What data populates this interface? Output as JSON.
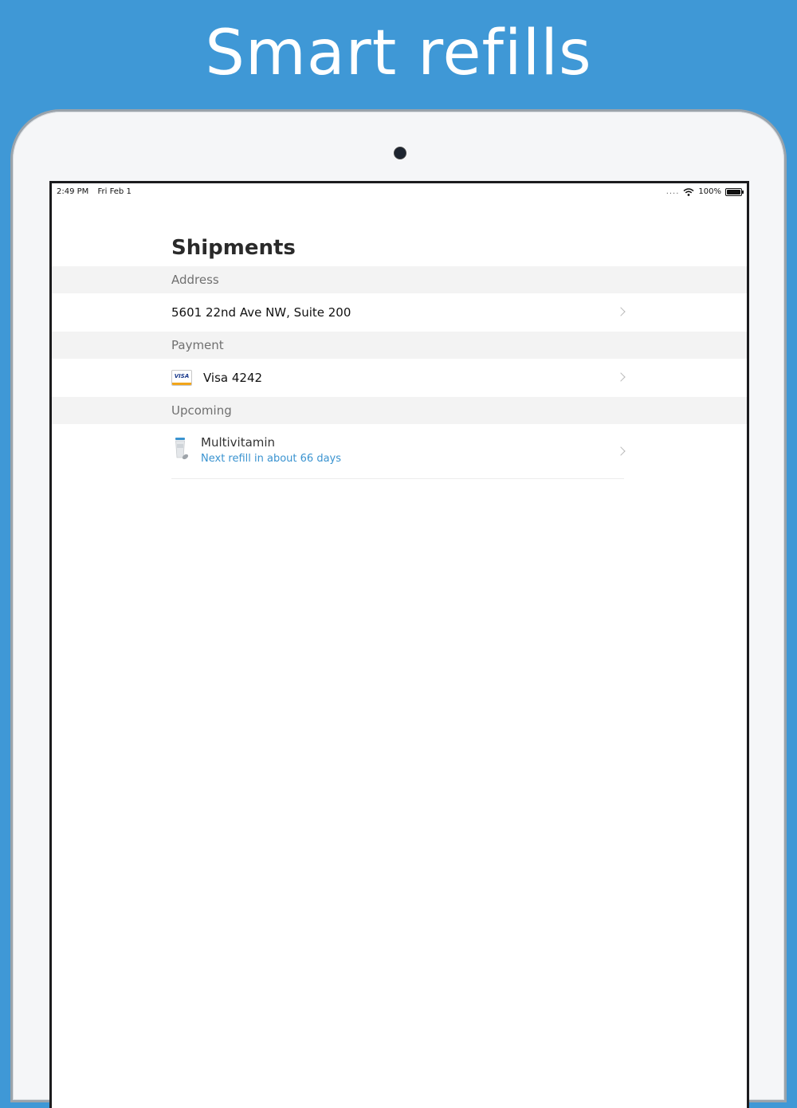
{
  "headline": "Smart refills",
  "status_bar": {
    "time": "2:49 PM",
    "date": "Fri Feb 1",
    "signal": "....",
    "battery": "100%"
  },
  "page": {
    "title": "Shipments"
  },
  "sections": {
    "address": {
      "header": "Address",
      "value": "5601 22nd Ave NW, Suite 200"
    },
    "payment": {
      "header": "Payment",
      "card_brand": "VISA",
      "value": "Visa 4242"
    },
    "upcoming": {
      "header": "Upcoming",
      "item_name": "Multivitamin",
      "item_subtitle": "Next refill in about 66 days"
    }
  },
  "colors": {
    "background": "#3f98d6",
    "accent": "#3a93d0"
  }
}
